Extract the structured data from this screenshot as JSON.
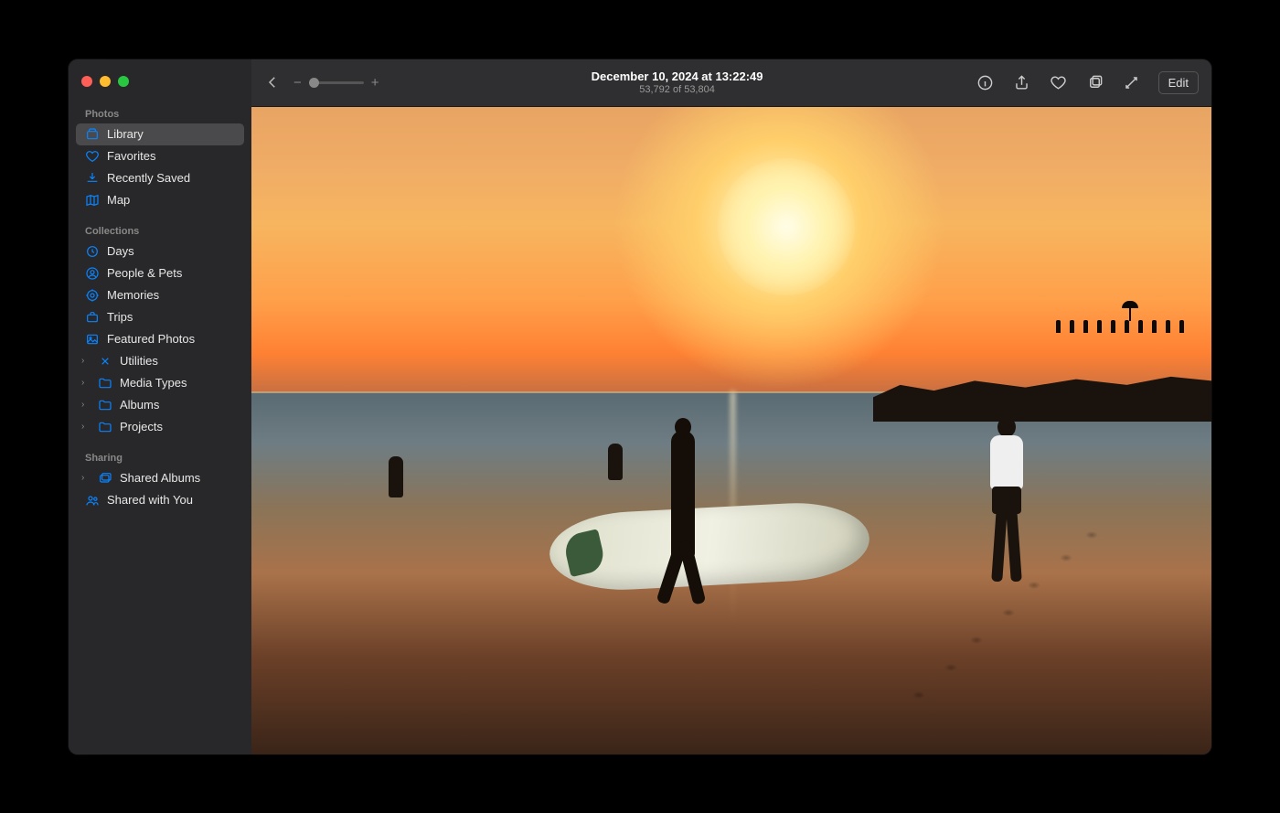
{
  "header": {
    "title": "December 10, 2024 at 13:22:49",
    "position": "53,792 of 53,804",
    "edit_label": "Edit"
  },
  "zoom": {
    "minus": "−",
    "plus": "+"
  },
  "sidebar": {
    "sections": [
      {
        "title": "Photos",
        "items": [
          {
            "label": "Library",
            "icon": "photo-stack-icon",
            "selected": true
          },
          {
            "label": "Favorites",
            "icon": "heart-outline-icon"
          },
          {
            "label": "Recently Saved",
            "icon": "download-clock-icon"
          },
          {
            "label": "Map",
            "icon": "map-icon"
          }
        ]
      },
      {
        "title": "Collections",
        "items": [
          {
            "label": "Days",
            "icon": "clock-icon"
          },
          {
            "label": "People & Pets",
            "icon": "person-circle-icon"
          },
          {
            "label": "Memories",
            "icon": "memories-icon"
          },
          {
            "label": "Trips",
            "icon": "suitcase-icon"
          },
          {
            "label": "Featured Photos",
            "icon": "featured-photo-icon"
          },
          {
            "label": "Utilities",
            "icon": "tools-icon",
            "disclosure": true
          },
          {
            "label": "Media Types",
            "icon": "folder-icon",
            "disclosure": true
          },
          {
            "label": "Albums",
            "icon": "folder-icon",
            "disclosure": true
          },
          {
            "label": "Projects",
            "icon": "folder-icon",
            "disclosure": true
          }
        ]
      },
      {
        "title": "Sharing",
        "items": [
          {
            "label": "Shared Albums",
            "icon": "shared-albums-icon",
            "disclosure": true
          },
          {
            "label": "Shared with You",
            "icon": "people-icon"
          }
        ]
      }
    ]
  },
  "photo": {
    "description": "Sunset beach scene with a silhouetted person carrying a surfboard, another person walking on the sand, people wading in the water, and onlookers on a rocky outcrop."
  }
}
